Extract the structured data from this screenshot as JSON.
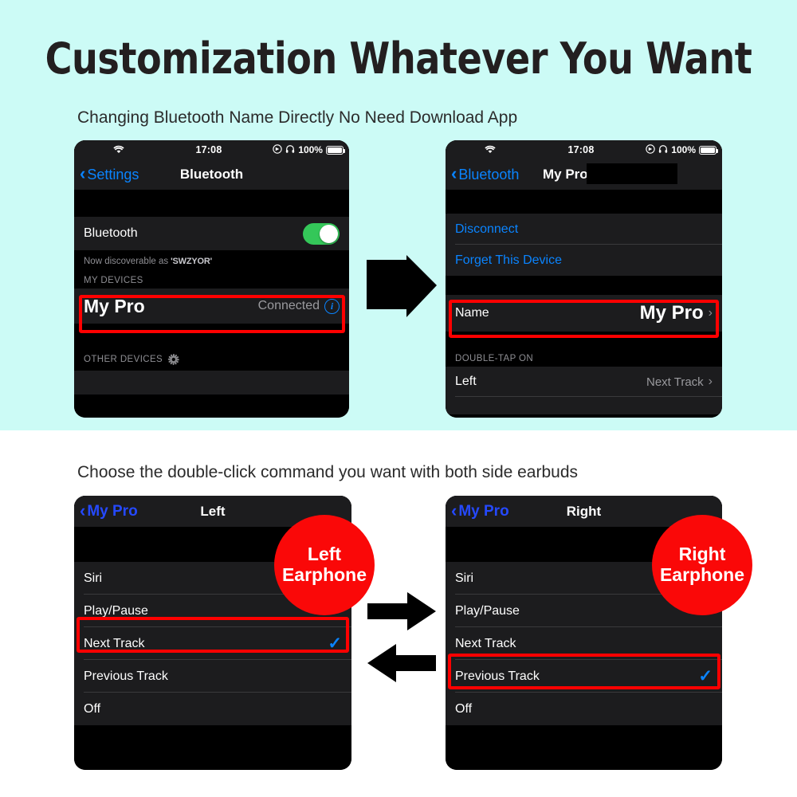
{
  "headline": "Customization Whatever You Want",
  "sections": {
    "top_caption": "Changing Bluetooth Name Directly No Need Download App",
    "bottom_caption": "Choose the double-click command you want with both side earbuds"
  },
  "colors": {
    "background_top": "#ccfbf6",
    "background_bottom": "#ffffff",
    "accent_blue": "#0a84ff",
    "highlight_red": "#ff0000",
    "badge_red": "#fa0808",
    "toggle_green": "#34c759",
    "headline_text": "#231f20"
  },
  "status_bar": {
    "wifi_icon": "wifi-icon",
    "time": "17:08",
    "location_icon": "location-icon",
    "headphones_icon": "headphones-icon",
    "battery_percent": "100%",
    "battery_icon": "battery-full-icon"
  },
  "phone_bluetooth": {
    "nav": {
      "back_icon": "chevron-left-icon",
      "back_label": "Settings",
      "title": "Bluetooth"
    },
    "bluetooth_row": {
      "label": "Bluetooth",
      "toggle_state": "on"
    },
    "discoverable": {
      "prefix": "Now discoverable as",
      "name": "'SWZYOR'"
    },
    "my_devices_header": "MY DEVICES",
    "device": {
      "name": "My Pro",
      "status": "Connected",
      "info_icon": "info-circle-icon"
    },
    "other_devices_header": "OTHER DEVICES",
    "spinner_icon": "loading-spinner-icon"
  },
  "phone_device": {
    "nav": {
      "back_icon": "chevron-left-icon",
      "back_label": "Bluetooth",
      "title": "My Pro"
    },
    "actions": [
      {
        "label": "Disconnect"
      },
      {
        "label": "Forget This Device"
      }
    ],
    "name_row": {
      "label": "Name",
      "value": "My Pro",
      "chevron_icon": "chevron-right-icon"
    },
    "double_tap_header": "DOUBLE-TAP ON",
    "double_tap_rows": [
      {
        "label": "Left",
        "value": "Next Track",
        "chevron_icon": "chevron-right-icon"
      }
    ]
  },
  "phone_left": {
    "nav": {
      "back_icon": "chevron-left-icon",
      "back_label": "My Pro",
      "title": "Left"
    },
    "options": [
      {
        "label": "Siri",
        "selected": false
      },
      {
        "label": "Play/Pause",
        "selected": false
      },
      {
        "label": "Next Track",
        "selected": true
      },
      {
        "label": "Previous Track",
        "selected": false
      },
      {
        "label": "Off",
        "selected": false
      }
    ],
    "check_icon": "check-icon",
    "badge": {
      "line1": "Left",
      "line2": "Earphone"
    }
  },
  "phone_right": {
    "nav": {
      "back_icon": "chevron-left-icon",
      "back_label": "My Pro",
      "title": "Right"
    },
    "options": [
      {
        "label": "Siri",
        "selected": false
      },
      {
        "label": "Play/Pause",
        "selected": false
      },
      {
        "label": "Next Track",
        "selected": false
      },
      {
        "label": "Previous Track",
        "selected": true
      },
      {
        "label": "Off",
        "selected": false
      }
    ],
    "check_icon": "check-icon",
    "badge": {
      "line1": "Right",
      "line2": "Earphone"
    }
  },
  "arrows": {
    "top": "arrow-right-icon",
    "bottom_1": "arrow-right-icon",
    "bottom_2": "arrow-left-icon"
  }
}
